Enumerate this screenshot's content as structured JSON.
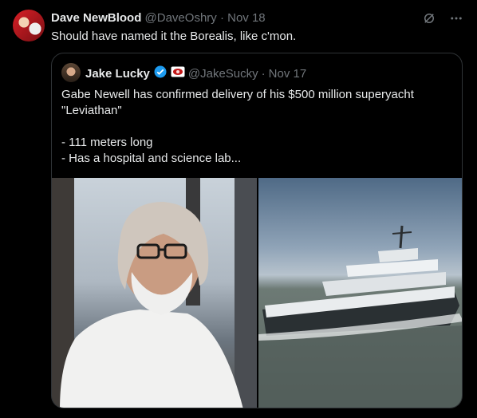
{
  "tweet": {
    "display_name": "Dave NewBlood",
    "handle": "@DaveOshry",
    "date": "Nov 18",
    "text": "Should have named it the Borealis, like c'mon."
  },
  "icons": {
    "grok": "grok-icon",
    "more": "more-dots-icon",
    "verified": "verified-badge-icon",
    "affiliate": "affiliate-badge-icon"
  },
  "quoted": {
    "display_name": "Jake Lucky",
    "handle": "@JakeSucky",
    "date": "Nov 17",
    "lines": [
      "Gabe Newell has confirmed delivery of his $500 million superyacht",
      "\"Leviathan\"",
      "",
      "- 111 meters long",
      "- Has a hospital and science lab..."
    ],
    "media": [
      {
        "kind": "photo",
        "subject": "man-with-glasses-portrait"
      },
      {
        "kind": "photo",
        "subject": "superyacht-at-sea"
      }
    ]
  },
  "colors": {
    "background": "#000000",
    "text": "#e7e9ea",
    "muted": "#71767b",
    "border": "#2f3336",
    "verified": "#1d9bf0"
  }
}
